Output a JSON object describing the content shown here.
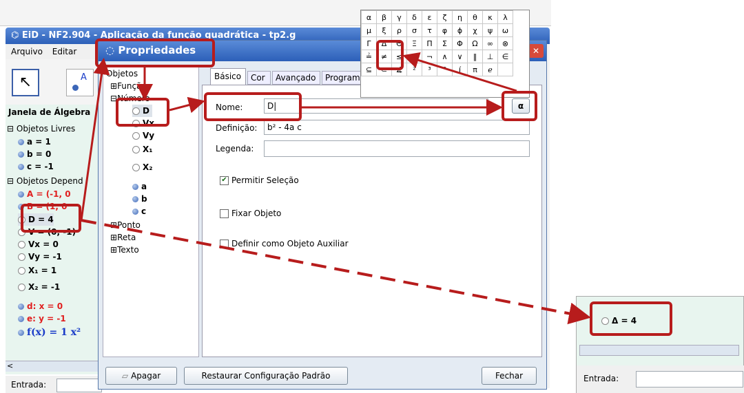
{
  "main_window": {
    "title": "EiD - NF2.904 - Aplicação da função quadrática - tp2.g",
    "menu": [
      "Arquivo",
      "Editar"
    ],
    "algebra_title": "Janela de Álgebra",
    "free_objects": "Objetos Livres",
    "free_items": [
      "a = 1",
      "b = 0",
      "c = -1"
    ],
    "dependent_objects": "Objetos Depend",
    "dep_items": [
      {
        "label": "A = (-1, 0",
        "color": "#e02020"
      },
      {
        "label": "B = (1, 0",
        "color": "#e02020"
      },
      {
        "label": "D = 4",
        "color": "#000000"
      },
      {
        "label": "V = (0, -1)",
        "color": "#000000"
      },
      {
        "label": "Vx = 0",
        "color": "#000000"
      },
      {
        "label": "Vy = -1",
        "color": "#000000"
      },
      {
        "label": "X₁ = 1",
        "color": "#000000"
      },
      {
        "label": "X₂ = -1",
        "color": "#000000"
      },
      {
        "label": "d: x = 0",
        "color": "#e02020"
      },
      {
        "label": "e: y = -1",
        "color": "#e02020"
      },
      {
        "label": "f(x) = 1 x²",
        "color": "#1a3cc8"
      }
    ],
    "input_label": "Entrada:"
  },
  "dialog": {
    "title": "Propriedades",
    "tree_root": "Objetos",
    "tree_groups": [
      "Função",
      "Número"
    ],
    "number_items": [
      "D",
      "Vx",
      "Vy",
      "X₁",
      "X₂",
      "a",
      "b",
      "c"
    ],
    "other_groups": [
      "Ponto",
      "Reta",
      "Texto"
    ],
    "tabs": [
      "Básico",
      "Cor",
      "Avançado",
      "Program"
    ],
    "name_label": "Nome:",
    "name_value": "D",
    "definition_label": "Definição:",
    "definition_value": "b² - 4a c",
    "caption_label": "Legenda:",
    "caption_value": "",
    "allow_selection": "Permitir Seleção",
    "fix_object": "Fixar Objeto",
    "auxiliary": "Definir como Objeto Auxiliar",
    "alpha_button": "α",
    "delete_button": "Apagar",
    "restore_button": "Restaurar Configuração Padrão",
    "close_button": "Fechar"
  },
  "greek_table": [
    [
      "α",
      "β",
      "γ",
      "δ",
      "ε",
      "ζ",
      "η",
      "θ",
      "κ",
      "λ"
    ],
    [
      "μ",
      "ξ",
      "ρ",
      "σ",
      "τ",
      "φ",
      "ϕ",
      "χ",
      "ψ",
      "ω"
    ],
    [
      "Γ",
      "Δ",
      "Θ",
      "Ξ",
      "Π",
      "Σ",
      "Φ",
      "Ω",
      "∞",
      "⊗"
    ],
    [
      "≟",
      "≠",
      "≤",
      "≥",
      "¬",
      "∧",
      "∨",
      "‖",
      "⊥",
      "∈"
    ],
    [
      "⊆",
      "⊂",
      "∡",
      "²",
      "³",
      "°",
      "í",
      "π",
      "ℯ",
      ""
    ]
  ],
  "result_panel": {
    "item": "Δ = 4",
    "input_label": "Entrada:"
  },
  "colors": {
    "highlight": "#b71c1c",
    "title_blue": "#2c5fb8"
  }
}
